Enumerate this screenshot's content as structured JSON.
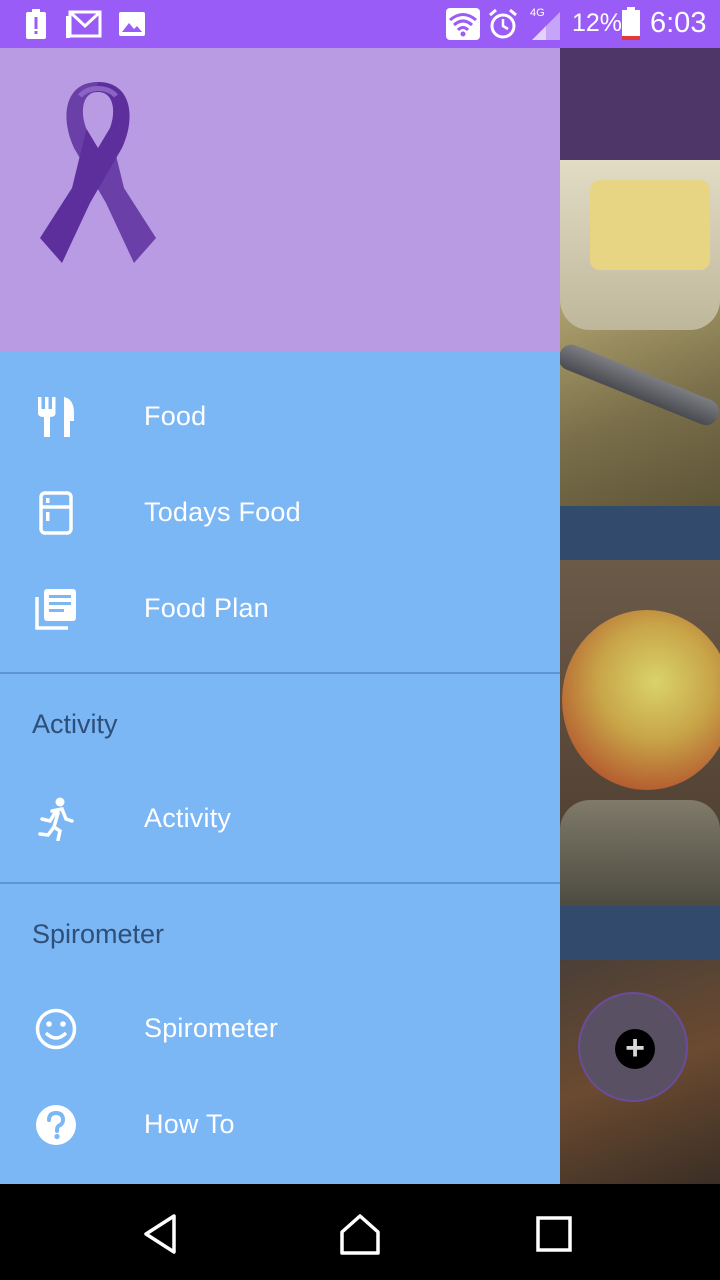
{
  "status_bar": {
    "battery_percent": "12%",
    "time": "6:03",
    "network": "4G",
    "icons": [
      "battery-alert-icon",
      "gmail-icon",
      "image-icon",
      "wifi-icon",
      "alarm-icon",
      "signal-icon",
      "battery-icon"
    ]
  },
  "drawer": {
    "header": {
      "logo": "awareness-ribbon-logo",
      "color": "#b99be3"
    },
    "background": "#7bb6f5",
    "items": [
      {
        "label": "Food",
        "icon": "fork-knife-icon"
      },
      {
        "label": "Todays Food",
        "icon": "fridge-icon"
      },
      {
        "label": "Food Plan",
        "icon": "library-books-icon"
      }
    ],
    "sections": [
      {
        "title": "Activity",
        "items": [
          {
            "label": "Activity",
            "icon": "run-icon"
          }
        ]
      },
      {
        "title": "Spirometer",
        "items": [
          {
            "label": "Spirometer",
            "icon": "smiley-icon"
          },
          {
            "label": "How To",
            "icon": "help-circle-icon"
          }
        ]
      }
    ]
  },
  "fab": {
    "icon": "add-circle-icon"
  },
  "nav_bar": {
    "buttons": [
      "back-icon",
      "home-icon",
      "recents-icon"
    ]
  },
  "colors": {
    "status_bar": "#9a5cf6",
    "section_title": "#2e4f78",
    "label": "#ffffff"
  }
}
